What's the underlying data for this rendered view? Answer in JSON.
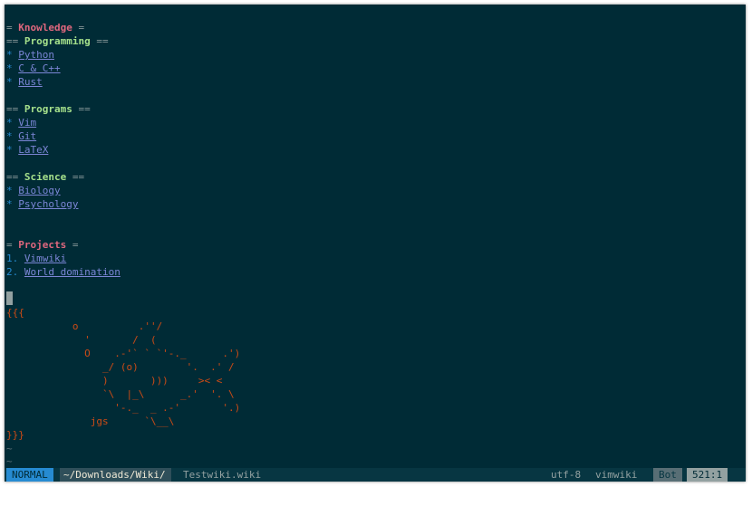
{
  "wiki": {
    "knowledge": {
      "open": "= ",
      "title": "Knowledge",
      "close": " ="
    },
    "programming": {
      "open": "== ",
      "title": "Programming",
      "close": " =="
    },
    "programming_items": [
      "Python",
      "C & C++",
      "Rust"
    ],
    "programs": {
      "open": "== ",
      "title": "Programs",
      "close": " =="
    },
    "programs_items": [
      "Vim",
      "Git",
      "LaTeX"
    ],
    "science": {
      "open": "== ",
      "title": "Science",
      "close": " =="
    },
    "science_items": [
      "Biology",
      "Psychology"
    ],
    "projects": {
      "open": "= ",
      "title": "Projects",
      "close": " ="
    },
    "projects_items": [
      {
        "num": "1. ",
        "text": "Vimwiki"
      },
      {
        "num": "2. ",
        "text": "World domination"
      }
    ],
    "bullet": "* ",
    "code_open": "{{{",
    "code_close": "}}}",
    "ascii_art": [
      "           o          .''/",
      "             '       /  (",
      "             O    .-'` ` `'-._      .')",
      "                _/ (o)        '.  .' /",
      "                )       )))     >< <",
      "                `\\  |_\\      _.'  '. \\",
      "                  '-._  _ .-'       '.)",
      "              jgs      `\\__\\"
    ],
    "tilde": "~"
  },
  "statusline": {
    "mode": "NORMAL",
    "path": "~/Downloads/Wiki/",
    "file": "Testwiki.wiki",
    "encoding": "utf-8",
    "filetype": "vimwiki",
    "percent": "Bot",
    "position": "521:1"
  },
  "colors": {
    "background": "#002b36",
    "h1": "#e0677e",
    "h2": "#a5e08b",
    "link": "#7b86d6",
    "ascii": "#cb4b16",
    "mode_bg": "#268bd2"
  }
}
